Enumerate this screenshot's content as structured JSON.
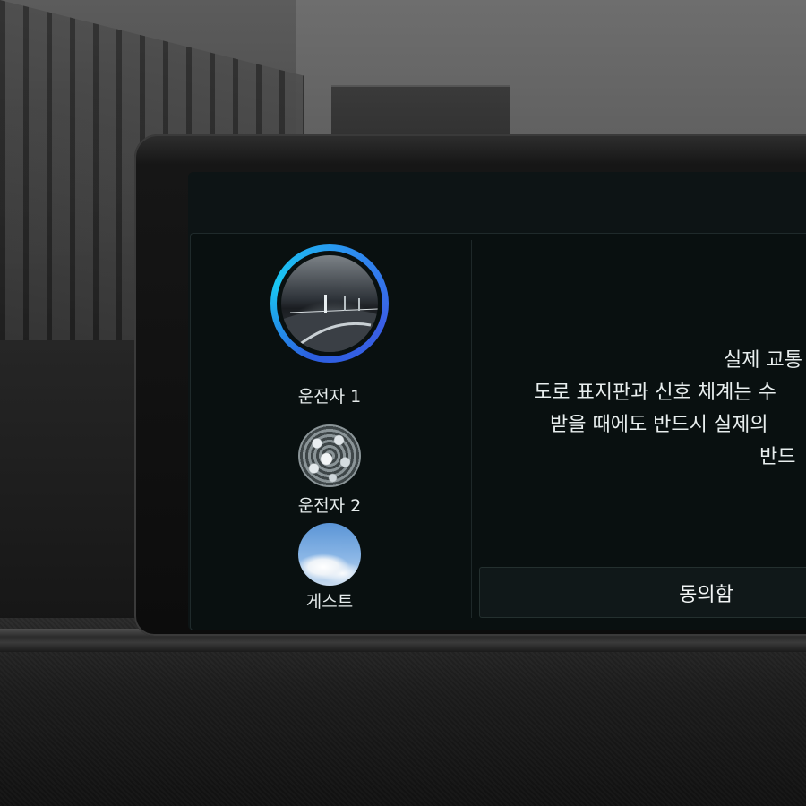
{
  "profiles": [
    {
      "name": "운전자 1",
      "avatar": "road-photo",
      "selected": true
    },
    {
      "name": "운전자 2",
      "avatar": "droplets-photo",
      "selected": false
    },
    {
      "name": "게스트",
      "avatar": "sky-clouds-photo",
      "selected": false
    }
  ],
  "terms": {
    "lines": [
      "실제 교통",
      "도로 표지판과 신호 체계는 수",
      "받을 때에도 반드시 실제의",
      "반드"
    ]
  },
  "agree_button": {
    "label": "동의함"
  },
  "colors": {
    "accent_ring": "#1fb6f0",
    "panel_background": "#091010",
    "text": "#e8eeee"
  }
}
